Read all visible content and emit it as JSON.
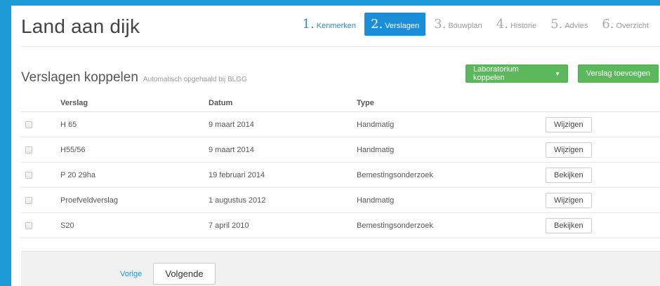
{
  "header": {
    "title": "Land aan dijk",
    "steps": [
      {
        "num": "1.",
        "label": "Kenmerken",
        "state": "done"
      },
      {
        "num": "2.",
        "label": "Verslagen",
        "state": "active"
      },
      {
        "num": "3.",
        "label": "Bouwplan",
        "state": "todo"
      },
      {
        "num": "4.",
        "label": "Historie",
        "state": "todo"
      },
      {
        "num": "5.",
        "label": "Advies",
        "state": "todo"
      },
      {
        "num": "6.",
        "label": "Overzicht",
        "state": "todo"
      }
    ]
  },
  "section": {
    "title": "Verslagen koppelen",
    "subtitle": "Automatisch opgehaald bij BLGG",
    "lab_button": "Laboratorium koppelen",
    "add_button": "Verslag toevoegen"
  },
  "table": {
    "columns": [
      "Verslag",
      "Datum",
      "Type"
    ],
    "rows": [
      {
        "verslag": "H 65",
        "datum": "9 maart 2014",
        "type": "Handmatig",
        "action": "Wijzigen"
      },
      {
        "verslag": "H55/56",
        "datum": "9 maart 2014",
        "type": "Handmatig",
        "action": "Wijzigen"
      },
      {
        "verslag": "P 20 29ha",
        "datum": "19 februari 2014",
        "type": "Bemestingsonderzoek",
        "action": "Bekijken"
      },
      {
        "verslag": "Proefveldverslag",
        "datum": "1 augustus 2012",
        "type": "Handmatig",
        "action": "Wijzigen"
      },
      {
        "verslag": "S20",
        "datum": "7 april 2010",
        "type": "Bemestingsonderzoek",
        "action": "Bekijken"
      }
    ]
  },
  "pagination": {
    "prev_label": "Vorige",
    "next_label": "Volgende"
  },
  "colors": {
    "accent": "#1a8fd8",
    "background": "#1d9bd6",
    "green": "#5cb85c"
  }
}
